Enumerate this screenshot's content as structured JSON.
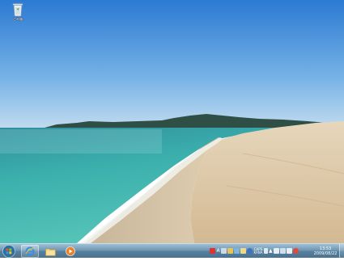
{
  "desktop": {
    "icons": [
      {
        "label": "ごみ箱",
        "icon": "recycle-bin-icon"
      }
    ],
    "wallpaper": "beach-scene"
  },
  "taskbar": {
    "start_icon": "windows-start-orb",
    "pinned": [
      {
        "name": "internet-explorer-icon",
        "active": true
      },
      {
        "name": "folder-icon",
        "active": false
      },
      {
        "name": "media-player-icon",
        "active": false
      }
    ],
    "tray": {
      "ime_label_1": "CAPS",
      "ime_label_2": "KANA",
      "language_label": "A"
    },
    "clock": {
      "time": "13:53",
      "date": "2009/08/22"
    }
  },
  "colors": {
    "sky_top": "#2e7fd6",
    "sky_bottom": "#b4d4ee",
    "sea": "#3fb6b2",
    "sand": "#dcc7a6",
    "taskbar": "#6f97b3"
  }
}
